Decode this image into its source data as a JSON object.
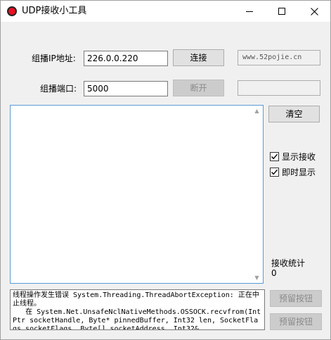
{
  "window": {
    "title": "UDP接收小工具"
  },
  "form": {
    "ip_label": "组播IP地址:",
    "ip_value": "226.0.0.220",
    "port_label": "组播端口:",
    "port_value": "5000",
    "connect_label": "连接",
    "disconnect_label": "断开",
    "site_text": "www.52pojie.cn",
    "site_text2": ""
  },
  "side": {
    "clear_label": "清空",
    "show_recv_label": "显示接收",
    "show_recv_checked": true,
    "instant_label": "即时显示",
    "instant_checked": true,
    "stats_label": "接收统计",
    "stats_value": "0",
    "reserved1_label": "预留按钮",
    "reserved2_label": "预留按钮"
  },
  "log": {
    "text": "线程操作发生错误 System.Threading.ThreadAbortException: 正在中止线程。\n   在 System.Net.UnsafeNclNativeMethods.OSSOCK.recvfrom(IntPtr socketHandle, Byte* pinnedBuffer, Int32 len, SocketFlags socketFlags, Byte[] socketAddress, Int32&"
  }
}
